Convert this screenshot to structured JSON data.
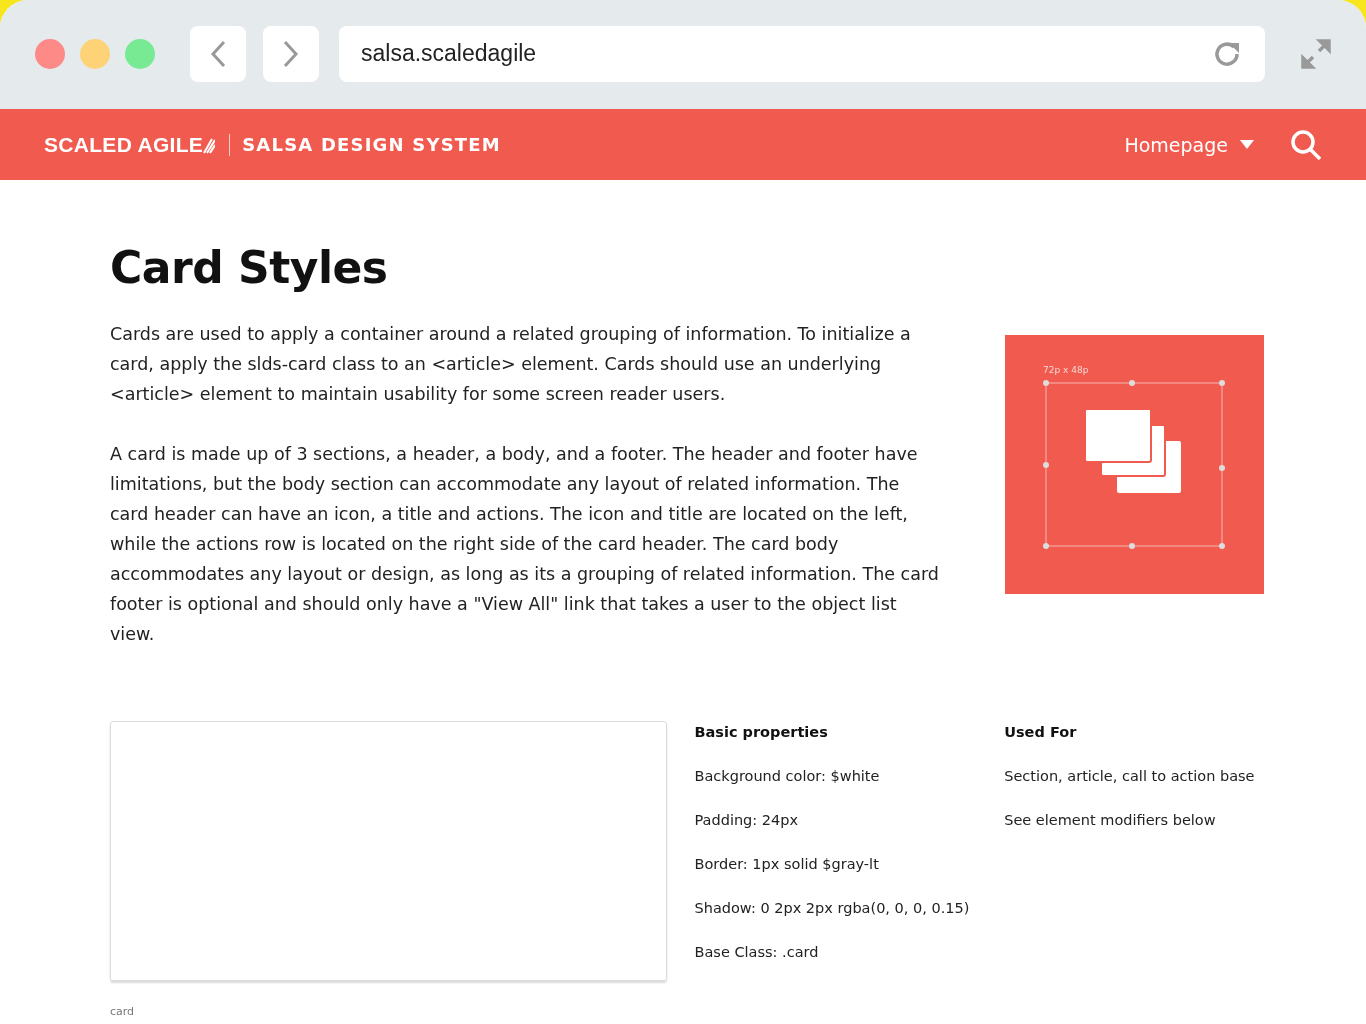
{
  "browser": {
    "url": "salsa.scaledagile"
  },
  "header": {
    "brand": "SCALED AGILE",
    "site": "SALSA DESIGN SYSTEM",
    "nav": "Homepage"
  },
  "page": {
    "title": "Card Styles",
    "paragraphs": [
      "Cards are used to apply a container around a related grouping of information. To initialize a card, apply the slds-card class to an <article> element. Cards should use an underlying <article> element to maintain usability for some screen reader users.",
      "A card is made up of 3 sections, a header, a body, and a footer. The header and footer have limitations, but the body section can accommodate any layout of related information. The card header can have an icon, a title and actions. The icon and title are located on the left, while the actions row is located on the right side of the card header. The card body accommodates any layout or design, as long as its a grouping of related information. The card footer is optional and should only have a \"View All\" link that takes a user to the object list view."
    ],
    "illustration": {
      "dimension": "72p x 48p"
    }
  },
  "example": {
    "caption": "card",
    "properties": {
      "heading": "Basic properties",
      "items": [
        "Background color: $white",
        "Padding: 24px",
        "Border: 1px solid $gray-lt",
        "Shadow: 0 2px 2px rgba(0, 0, 0, 0.15)",
        "Base Class: .card"
      ]
    },
    "used_for": {
      "heading": "Used For",
      "items": [
        "Section, article, call to action base",
        "See element modifiers below"
      ]
    }
  }
}
